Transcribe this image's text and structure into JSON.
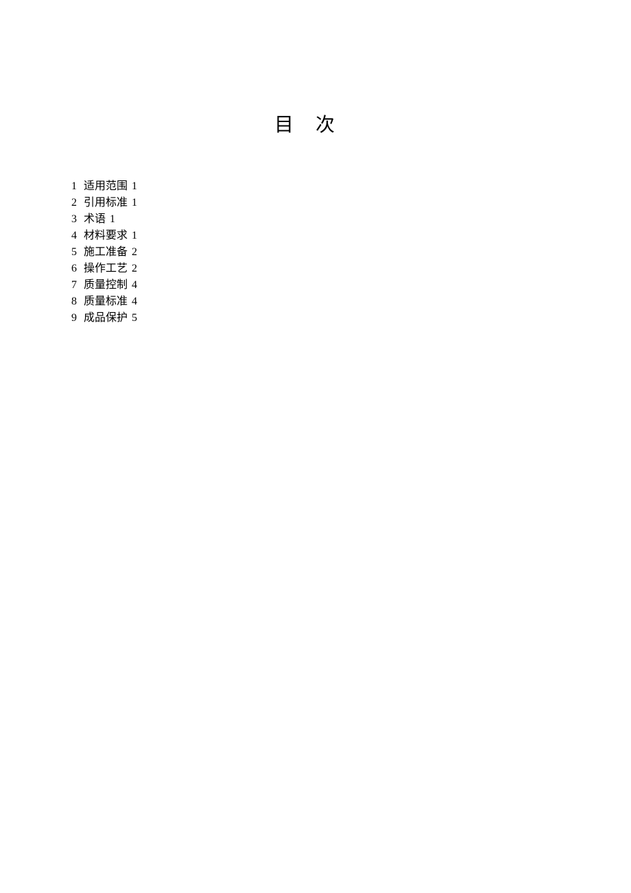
{
  "title": "目次",
  "toc": {
    "items": [
      {
        "number": "1",
        "text": "适用范围",
        "page": "1"
      },
      {
        "number": "2",
        "text": "引用标准",
        "page": "1"
      },
      {
        "number": "3",
        "text": "术语",
        "page": "1"
      },
      {
        "number": "4",
        "text": "材料要求",
        "page": "1"
      },
      {
        "number": "5",
        "text": "施工准备",
        "page": "2"
      },
      {
        "number": "6",
        "text": "操作工艺",
        "page": "2"
      },
      {
        "number": "7",
        "text": "质量控制",
        "page": "4"
      },
      {
        "number": "8",
        "text": "质量标准",
        "page": "4"
      },
      {
        "number": "9",
        "text": "成品保护",
        "page": "5"
      }
    ]
  }
}
